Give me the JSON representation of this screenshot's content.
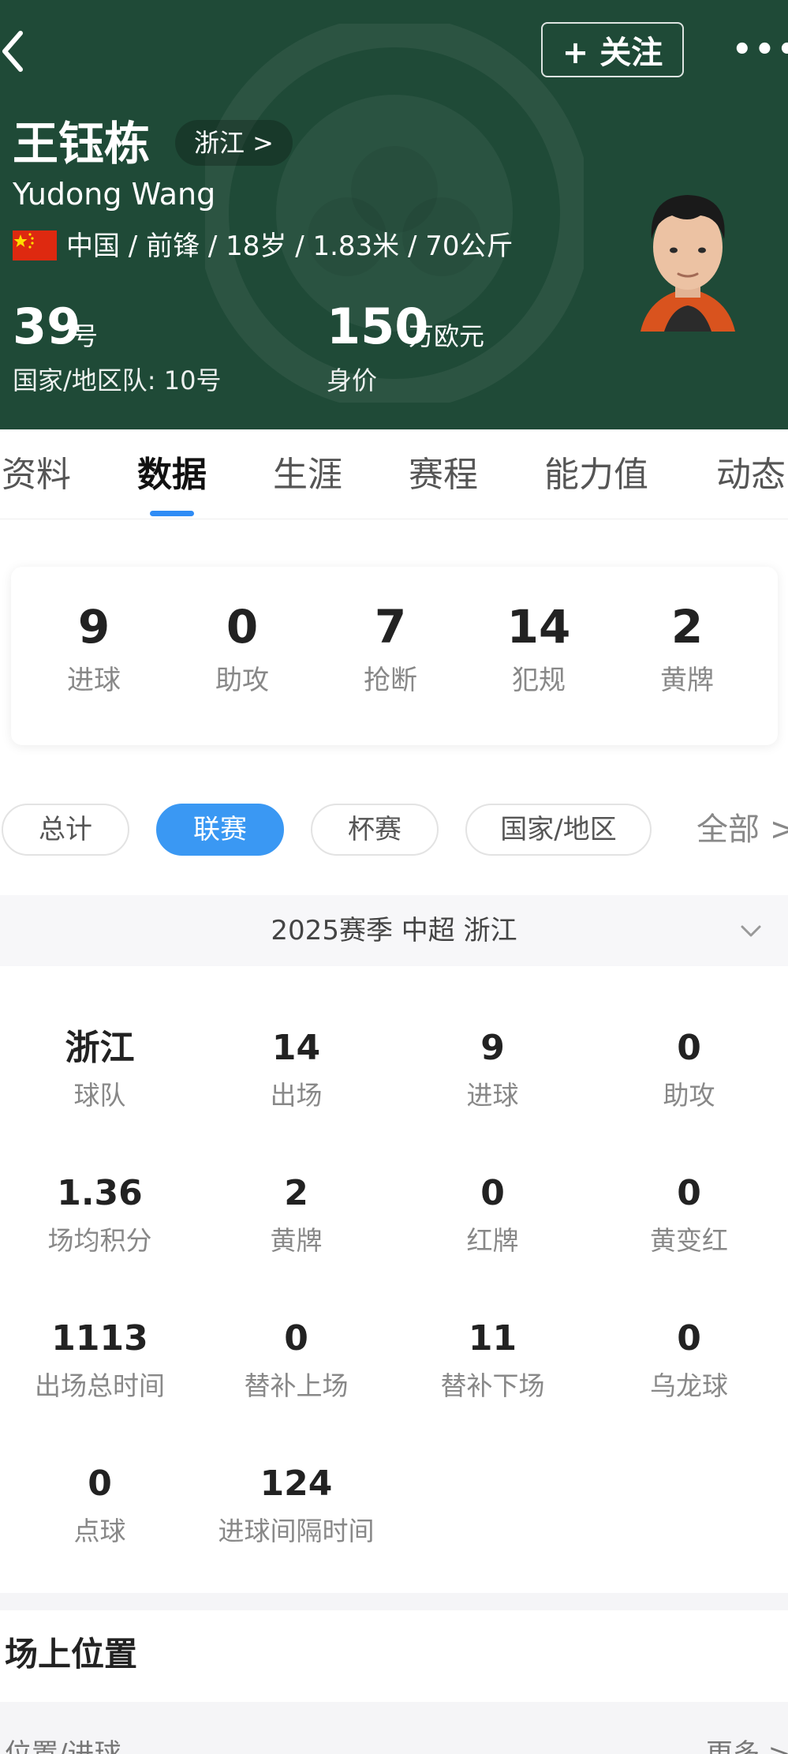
{
  "header": {
    "follow_label": "+ 关注",
    "more_label": "•••",
    "player_name": "王钰栋",
    "club_chip": "浙江 >",
    "player_en": "Yudong Wang",
    "info": "中国 / 前锋 / 18岁 / 1.83米 / 70公斤",
    "shirt_number": "39",
    "shirt_unit": "号",
    "national_label": "国家/地区队: 10号",
    "market_value": "150",
    "market_unit": "万欧元",
    "market_label": "身价",
    "colors": {
      "background": "#1f4a37",
      "flag": "#de2910"
    }
  },
  "tabs": [
    {
      "label": "资料"
    },
    {
      "label": "数据",
      "active": true
    },
    {
      "label": "生涯"
    },
    {
      "label": "赛程"
    },
    {
      "label": "能力值"
    },
    {
      "label": "动态"
    }
  ],
  "summary": [
    {
      "value": "9",
      "label": "进球"
    },
    {
      "value": "0",
      "label": "助攻"
    },
    {
      "value": "7",
      "label": "抢断"
    },
    {
      "value": "14",
      "label": "犯规"
    },
    {
      "value": "2",
      "label": "黄牌"
    }
  ],
  "filters": {
    "chips": [
      {
        "label": "总计"
      },
      {
        "label": "联赛",
        "active": true
      },
      {
        "label": "杯赛"
      },
      {
        "label": "国家/地区"
      }
    ],
    "all_label": "全部 >"
  },
  "season": {
    "label": "2025赛季  中超  浙江"
  },
  "stats": [
    {
      "value": "浙江",
      "label": "球队"
    },
    {
      "value": "14",
      "label": "出场"
    },
    {
      "value": "9",
      "label": "进球"
    },
    {
      "value": "0",
      "label": "助攻"
    },
    {
      "value": "1.36",
      "label": "场均积分"
    },
    {
      "value": "2",
      "label": "黄牌"
    },
    {
      "value": "0",
      "label": "红牌"
    },
    {
      "value": "0",
      "label": "黄变红"
    },
    {
      "value": "1113",
      "label": "出场总时间"
    },
    {
      "value": "0",
      "label": "替补上场"
    },
    {
      "value": "11",
      "label": "替补下场"
    },
    {
      "value": "0",
      "label": "乌龙球"
    },
    {
      "value": "0",
      "label": "点球"
    },
    {
      "value": "124",
      "label": "进球间隔时间"
    }
  ],
  "position": {
    "title": "场上位置",
    "row_left": "位置/进球",
    "row_right": "更多 >"
  },
  "accent_color": "#3a98f3"
}
